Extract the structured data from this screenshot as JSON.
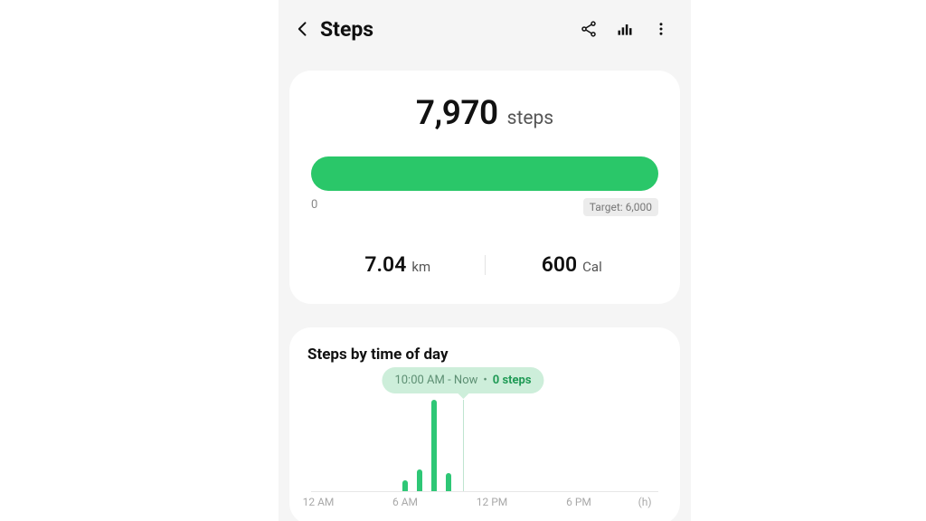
{
  "header": {
    "title": "Steps"
  },
  "summary": {
    "count": "7,970",
    "count_unit": "steps",
    "progress_min": "0",
    "target_label": "Target: 6,000",
    "distance_value": "7.04",
    "distance_unit": "km",
    "calories_value": "600",
    "calories_unit": "Cal"
  },
  "timechart": {
    "title": "Steps by time of day",
    "tooltip_time": "10:00 AM - Now",
    "tooltip_value": "0 steps",
    "xticks": [
      "12 AM",
      "6 AM",
      "12 PM",
      "6 PM"
    ],
    "xunit": "(h)"
  },
  "chart_data": {
    "type": "bar",
    "title": "Steps by time of day",
    "xlabel": "(h)",
    "ylabel": "steps",
    "categories": [
      0,
      1,
      2,
      3,
      4,
      5,
      6,
      7,
      8,
      9,
      10,
      11,
      12,
      13,
      14,
      15,
      16,
      17,
      18,
      19,
      20,
      21,
      22,
      23
    ],
    "values": [
      0,
      0,
      0,
      0,
      0,
      0,
      600,
      1200,
      5000,
      1000,
      0,
      0,
      0,
      0,
      0,
      0,
      0,
      0,
      0,
      0,
      0,
      0,
      0,
      0
    ],
    "now_hour": 10,
    "ylim": [
      0,
      5000
    ],
    "x_tick_hours": [
      0,
      6,
      12,
      18
    ],
    "x_tick_labels": [
      "12 AM",
      "6 AM",
      "12 PM",
      "6 PM"
    ]
  },
  "colors": {
    "accent": "#2ac769",
    "tooltip_bg": "#cdeeda"
  }
}
